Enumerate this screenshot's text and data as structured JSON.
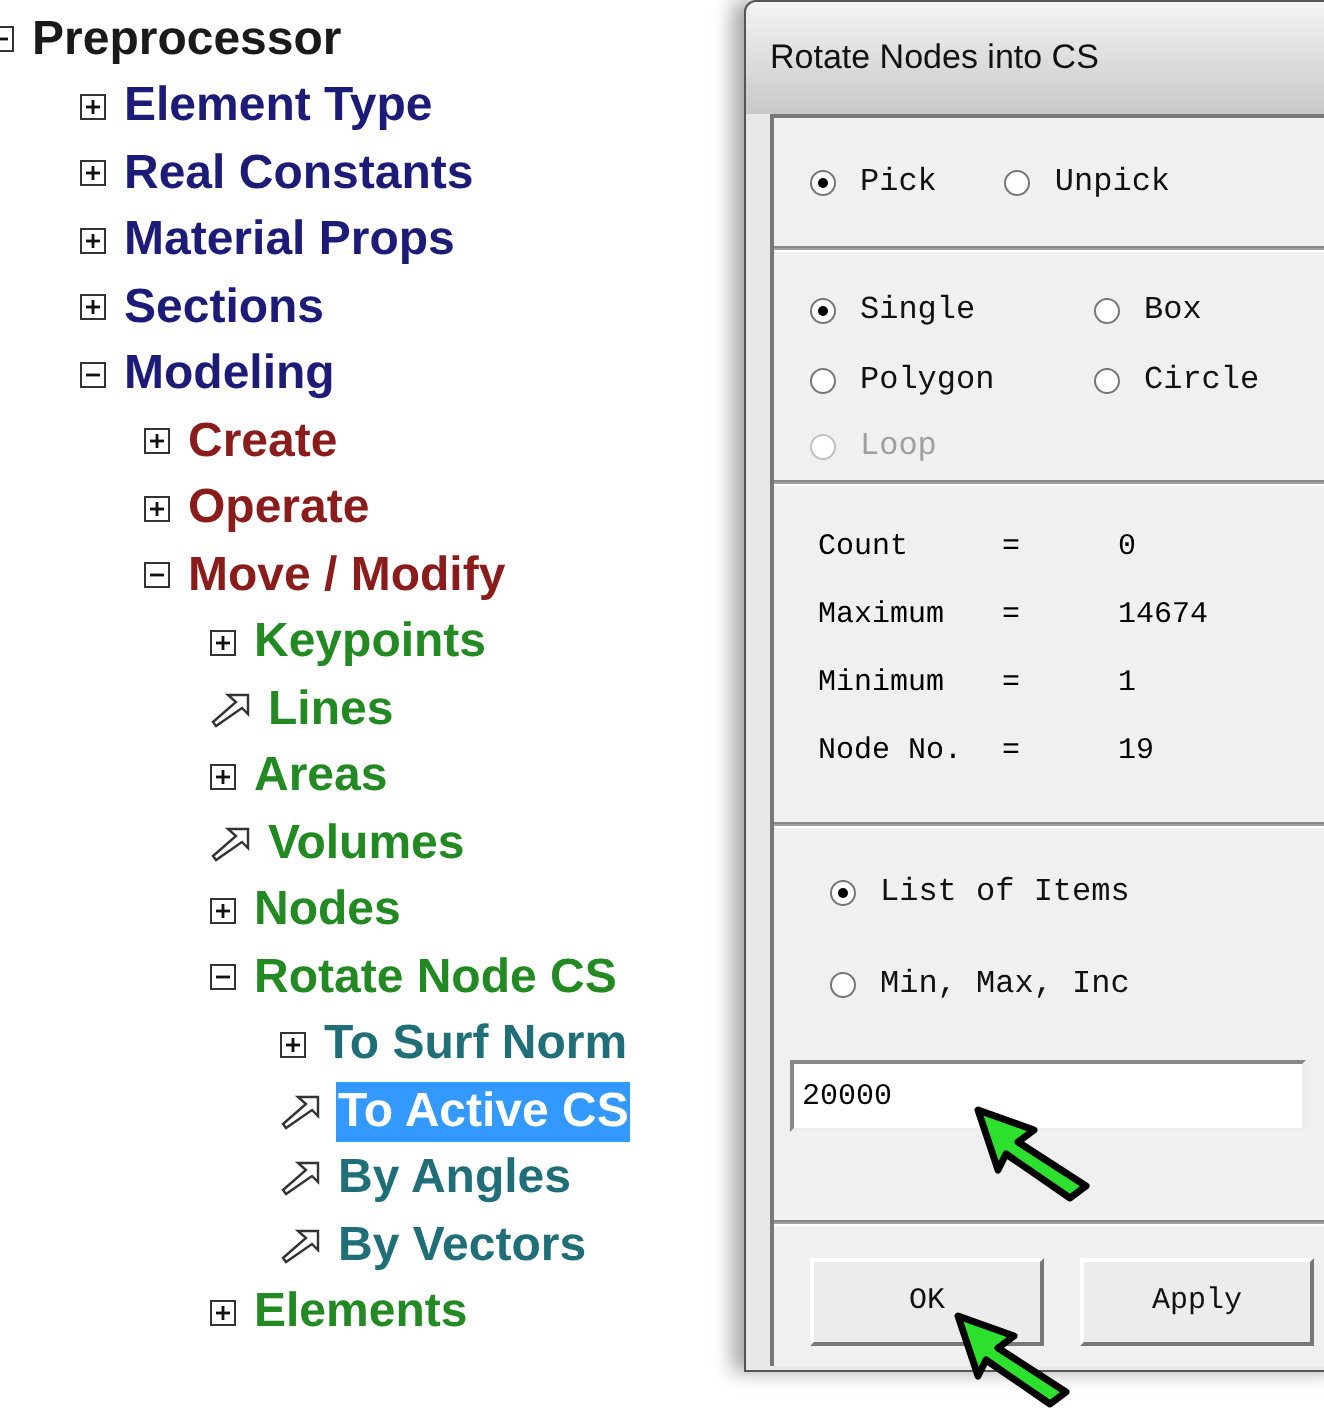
{
  "tree": {
    "label": "Preprocessor",
    "kind": "folder",
    "expanded": true,
    "selected": false,
    "children": [
      {
        "label": "Element Type",
        "kind": "folder",
        "expanded": false,
        "selected": false
      },
      {
        "label": "Real Constants",
        "kind": "folder",
        "expanded": false,
        "selected": false
      },
      {
        "label": "Material Props",
        "kind": "folder",
        "expanded": false,
        "selected": false
      },
      {
        "label": "Sections",
        "kind": "folder",
        "expanded": false,
        "selected": false
      },
      {
        "label": "Modeling",
        "kind": "folder",
        "expanded": true,
        "selected": false,
        "children": [
          {
            "label": "Create",
            "kind": "folder",
            "expanded": false,
            "selected": false
          },
          {
            "label": "Operate",
            "kind": "folder",
            "expanded": false,
            "selected": false
          },
          {
            "label": "Move / Modify",
            "kind": "folder",
            "expanded": true,
            "selected": false,
            "children": [
              {
                "label": "Keypoints",
                "kind": "folder",
                "expanded": false,
                "selected": false
              },
              {
                "label": "Lines",
                "kind": "action",
                "selected": false
              },
              {
                "label": "Areas",
                "kind": "folder",
                "expanded": false,
                "selected": false
              },
              {
                "label": "Volumes",
                "kind": "action",
                "selected": false
              },
              {
                "label": "Nodes",
                "kind": "folder",
                "expanded": false,
                "selected": false
              },
              {
                "label": "Rotate Node CS",
                "kind": "folder",
                "expanded": true,
                "selected": false,
                "children": [
                  {
                    "label": "To Surf Norm",
                    "kind": "folder",
                    "expanded": false,
                    "selected": false
                  },
                  {
                    "label": "To Active CS",
                    "kind": "action",
                    "selected": true
                  },
                  {
                    "label": "By Angles",
                    "kind": "action",
                    "selected": false
                  },
                  {
                    "label": "By Vectors",
                    "kind": "action",
                    "selected": false
                  }
                ]
              },
              {
                "label": "Elements",
                "kind": "folder",
                "expanded": false,
                "selected": false
              }
            ]
          }
        ]
      }
    ]
  },
  "dialog": {
    "title": "Rotate Nodes into CS",
    "pick_mode": [
      {
        "label": "Pick",
        "selected": true,
        "disabled": false
      },
      {
        "label": "Unpick",
        "selected": false,
        "disabled": false
      }
    ],
    "pick_shape": [
      {
        "label": "Single",
        "selected": true,
        "disabled": false
      },
      {
        "label": "Box",
        "selected": false,
        "disabled": false
      },
      {
        "label": "Polygon",
        "selected": false,
        "disabled": false
      },
      {
        "label": "Circle",
        "selected": false,
        "disabled": false
      },
      {
        "label": "Loop",
        "selected": false,
        "disabled": true
      }
    ],
    "stats": [
      {
        "label": "Count",
        "sign": "=",
        "value": "0"
      },
      {
        "label": "Maximum",
        "sign": "=",
        "value": "14674"
      },
      {
        "label": "Minimum",
        "sign": "=",
        "value": "1"
      },
      {
        "label": "Node No.",
        "sign": "=",
        "value": "19"
      }
    ],
    "input_mode": [
      {
        "label": "List of Items",
        "selected": true,
        "disabled": false
      },
      {
        "label": "Min, Max, Inc",
        "selected": false,
        "disabled": false
      }
    ],
    "input": {
      "value": "20000"
    },
    "buttons": [
      "OK",
      "Apply"
    ]
  }
}
